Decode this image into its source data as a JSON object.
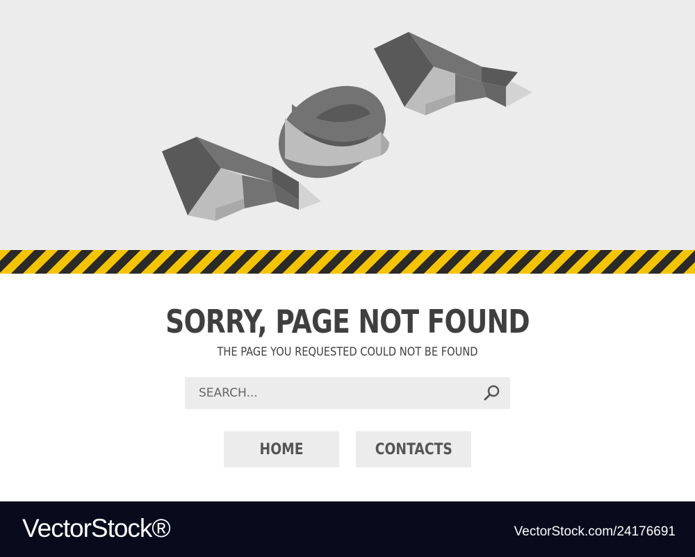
{
  "hero": {
    "code_text": "404",
    "colors": {
      "background": "#ececec",
      "wall_dark": "#595959",
      "wall_mid": "#737373",
      "floor_light": "#bdbdbd",
      "shadow": "#d3d3d3"
    }
  },
  "tape": {
    "colors": [
      "#f5c400",
      "#2a2a2a"
    ]
  },
  "error": {
    "title": "SORRY, PAGE NOT FOUND",
    "subtitle": "THE PAGE YOU REQUESTED COULD NOT BE FOUND"
  },
  "search": {
    "placeholder": "SEARCH...",
    "value": "",
    "icon": "search-icon"
  },
  "buttons": {
    "home": "HOME",
    "contacts": "CONTACTS"
  },
  "watermark": {
    "logo": "VectorStock®",
    "id": "VectorStock.com/24176691"
  }
}
